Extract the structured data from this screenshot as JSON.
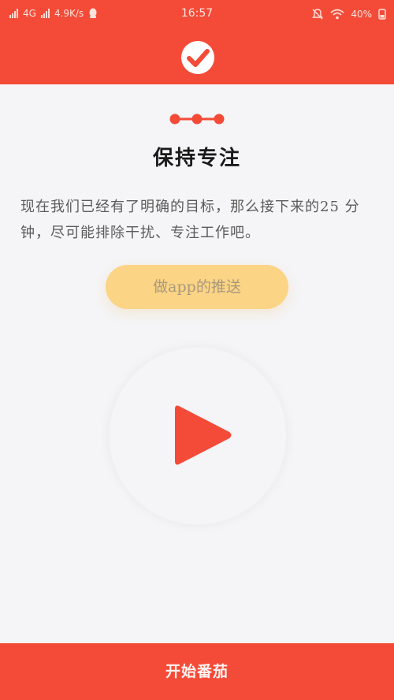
{
  "status_bar": {
    "network": "4G",
    "speed": "4.9K/s",
    "time": "16:57",
    "battery": "40%",
    "icons": [
      "signal-icon",
      "qq-icon",
      "mute-bell-icon",
      "wifi-icon",
      "battery-icon"
    ]
  },
  "header": {
    "logo_icon": "check-circle-icon"
  },
  "content": {
    "title": "保持专注",
    "description": "现在我们已经有了明确的目标，那么接下来的25 分钟，尽可能排除干扰、专注工作吧。",
    "push_button_label": "做app的推送",
    "play_icon": "play-icon"
  },
  "footer": {
    "start_label": "开始番茄"
  },
  "colors": {
    "primary": "#f44b38",
    "push_button_bg": "#fbd485",
    "background": "#f5f4f6"
  }
}
